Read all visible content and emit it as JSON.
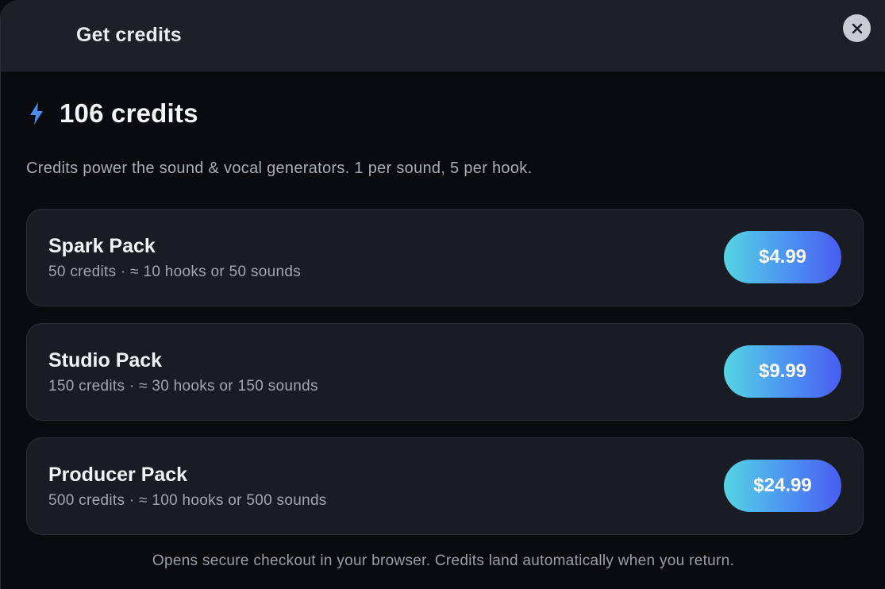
{
  "dialog": {
    "title": "Get credits",
    "close_icon": "close-icon"
  },
  "balance": {
    "icon": "lightning-bolt-icon",
    "text": "106 credits",
    "accent_color": "#4a8cf0"
  },
  "description": "Credits power the sound & vocal generators. 1 per sound, 5 per hook.",
  "packs": [
    {
      "name": "Spark Pack",
      "details": "50 credits · ≈ 10 hooks or 50 sounds",
      "price": "$4.99"
    },
    {
      "name": "Studio Pack",
      "details": "150 credits · ≈ 30 hooks or 150 sounds",
      "price": "$9.99"
    },
    {
      "name": "Producer Pack",
      "details": "500 credits · ≈ 100 hooks or 500 sounds",
      "price": "$24.99"
    }
  ],
  "footer_note": "Opens secure checkout in your browser. Credits land automatically when you return.",
  "colors": {
    "button_gradient_start": "#56d4e2",
    "button_gradient_end": "#4a5cf2",
    "card_background": "#1a1c23",
    "header_background": "#1d2026"
  }
}
